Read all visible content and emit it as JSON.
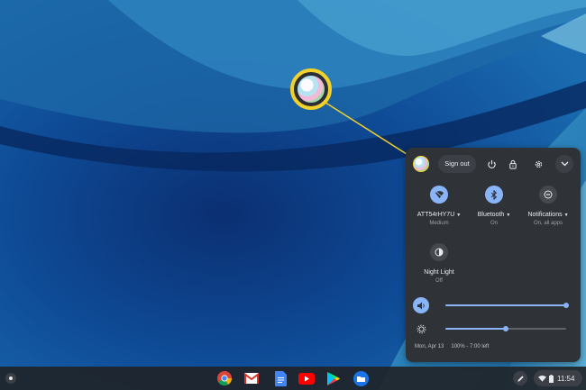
{
  "quick_settings": {
    "sign_out_label": "Sign out",
    "top_icons": [
      "power-icon",
      "lock-icon",
      "gear-icon",
      "chevron-down-icon"
    ],
    "wifi": {
      "label": "ATT54rHY7U",
      "status": "Medium",
      "icon": "wifi-icon",
      "on": true
    },
    "bluetooth": {
      "label": "Bluetooth",
      "status": "On",
      "icon": "bluetooth-icon",
      "on": true
    },
    "notifications": {
      "label": "Notifications",
      "status": "On, all apps",
      "icon": "do-not-disturb-icon",
      "on": false
    },
    "night_light": {
      "label": "Night Light",
      "status": "Off",
      "icon": "night-light-icon",
      "on": false
    },
    "volume": {
      "level": 1.0,
      "icon": "volume-icon"
    },
    "brightness": {
      "level": 0.5,
      "icon": "brightness-icon"
    },
    "date": "Mon, Apr 13",
    "battery": "100% - 7:00 left"
  },
  "shelf": {
    "apps": [
      "chrome-icon",
      "gmail-icon",
      "docs-icon",
      "youtube-icon",
      "play-store-icon",
      "files-icon"
    ],
    "time": "11:54"
  },
  "colors": {
    "accent": "#8ab4f8",
    "panel": "#2f3338",
    "callout": "#f2d12a",
    "wallpaper_dark": "#0b3f86",
    "wallpaper_light": "#2f86bf"
  }
}
